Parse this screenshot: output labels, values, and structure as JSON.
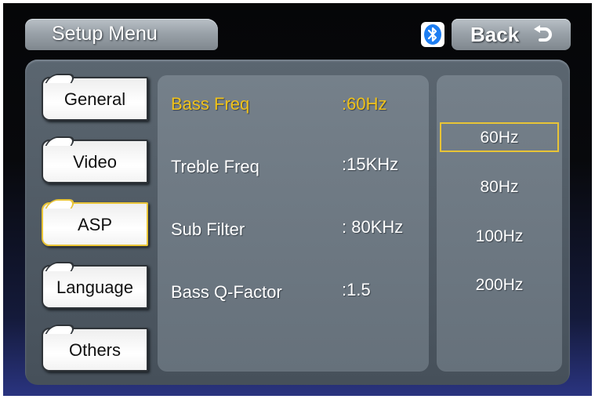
{
  "header": {
    "title": "Setup Menu",
    "back_label": "Back",
    "bluetooth_icon": "bluetooth-icon",
    "back_icon": "return-arrow-icon"
  },
  "tabs": [
    {
      "label": "General",
      "active": false
    },
    {
      "label": "Video",
      "active": false
    },
    {
      "label": "ASP",
      "active": true
    },
    {
      "label": "Language",
      "active": false
    },
    {
      "label": "Others",
      "active": false
    }
  ],
  "settings": [
    {
      "label": "Bass Freq",
      "value": ":60Hz",
      "active": true
    },
    {
      "label": "Treble Freq",
      "value": ":15KHz",
      "active": false
    },
    {
      "label": "Sub Filter",
      "value": ": 80KHz",
      "active": false
    },
    {
      "label": "Bass Q-Factor",
      "value": ":1.5",
      "active": false
    }
  ],
  "options": [
    {
      "label": "60Hz",
      "selected": true
    },
    {
      "label": "80Hz",
      "selected": false
    },
    {
      "label": "100Hz",
      "selected": false
    },
    {
      "label": "200Hz",
      "selected": false
    }
  ],
  "colors": {
    "accent": "#e8c436",
    "highlight_text": "#f0c21a",
    "bluetooth": "#1e7ef2"
  }
}
